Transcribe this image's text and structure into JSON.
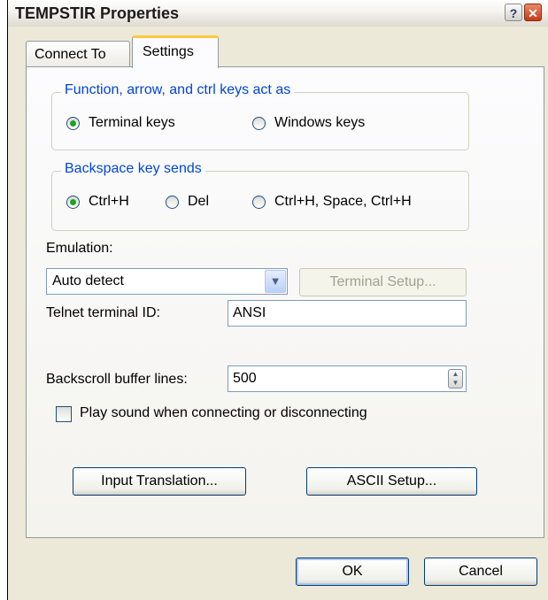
{
  "window": {
    "title": "TEMPSTIR Properties"
  },
  "titlebar": {
    "help_label": "?",
    "close_label": "✕"
  },
  "tabs": [
    {
      "label": "Connect To"
    },
    {
      "label": "Settings"
    }
  ],
  "settings": {
    "keys_group": {
      "legend": "Function, arrow, and ctrl keys act as",
      "options": [
        {
          "label": "Terminal keys",
          "checked": true
        },
        {
          "label": "Windows keys",
          "checked": false
        }
      ]
    },
    "backspace_group": {
      "legend": "Backspace key sends",
      "options": [
        {
          "label": "Ctrl+H",
          "checked": true
        },
        {
          "label": "Del",
          "checked": false
        },
        {
          "label": "Ctrl+H, Space, Ctrl+H",
          "checked": false
        }
      ]
    },
    "emulation": {
      "label": "Emulation:",
      "value": "Auto detect",
      "setup_button": "Terminal Setup..."
    },
    "telnet": {
      "label": "Telnet terminal ID:",
      "value": "ANSI"
    },
    "backscroll": {
      "label": "Backscroll buffer lines:",
      "value": "500"
    },
    "play_sound": {
      "label": "Play sound when connecting or disconnecting",
      "checked": false
    },
    "input_translation_button": "Input Translation...",
    "ascii_setup_button": "ASCII Setup..."
  },
  "footer": {
    "ok_label": "OK",
    "cancel_label": "Cancel"
  }
}
